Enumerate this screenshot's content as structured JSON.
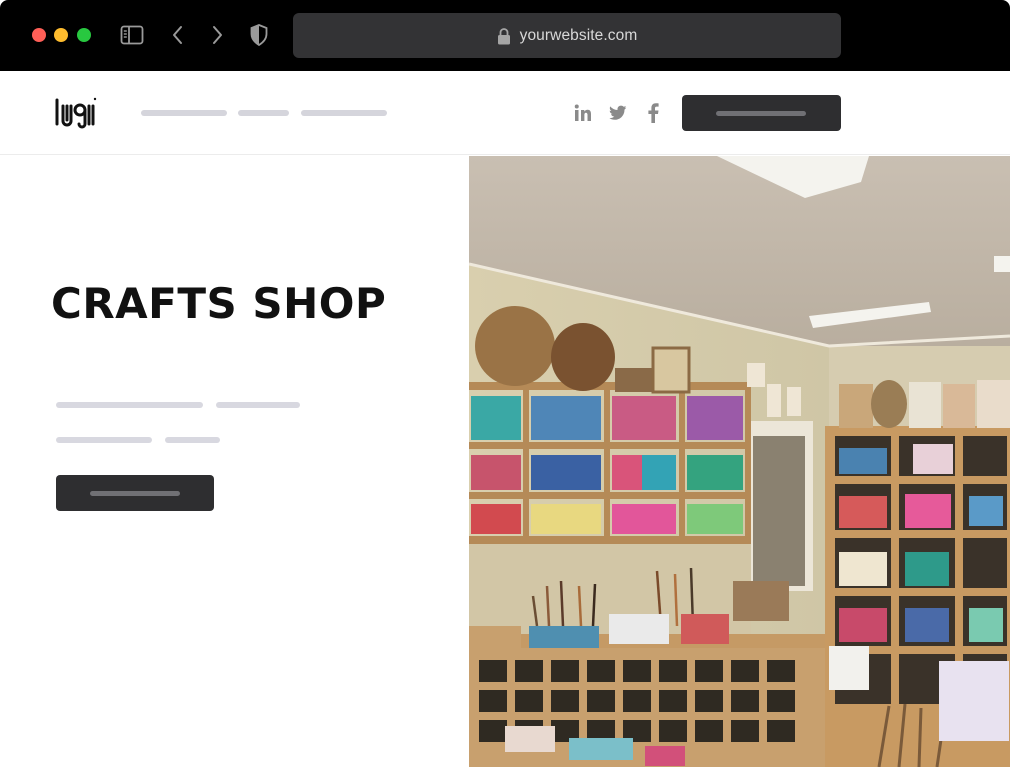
{
  "browser": {
    "url": "yourwebsite.com",
    "icons": [
      "close-dot",
      "minimize-dot",
      "maximize-dot",
      "sidebar-icon",
      "back-icon",
      "forward-icon",
      "shield-icon",
      "lock-icon"
    ]
  },
  "header": {
    "logo_text": "LOGO",
    "nav_links": [
      "placeholder-link",
      "placeholder-link",
      "placeholder-link"
    ],
    "social_icons": [
      "linkedin-icon",
      "twitter-icon",
      "facebook-icon"
    ]
  },
  "hero": {
    "title": "CRAFTS SHOP",
    "image": "crafts-shop-interior-photo"
  },
  "colors": {
    "chrome_bg": "#000000",
    "address_bg": "#333335",
    "button_bg": "#2e2e30",
    "placeholder_line": "#d8d8e0",
    "title": "#111111"
  }
}
